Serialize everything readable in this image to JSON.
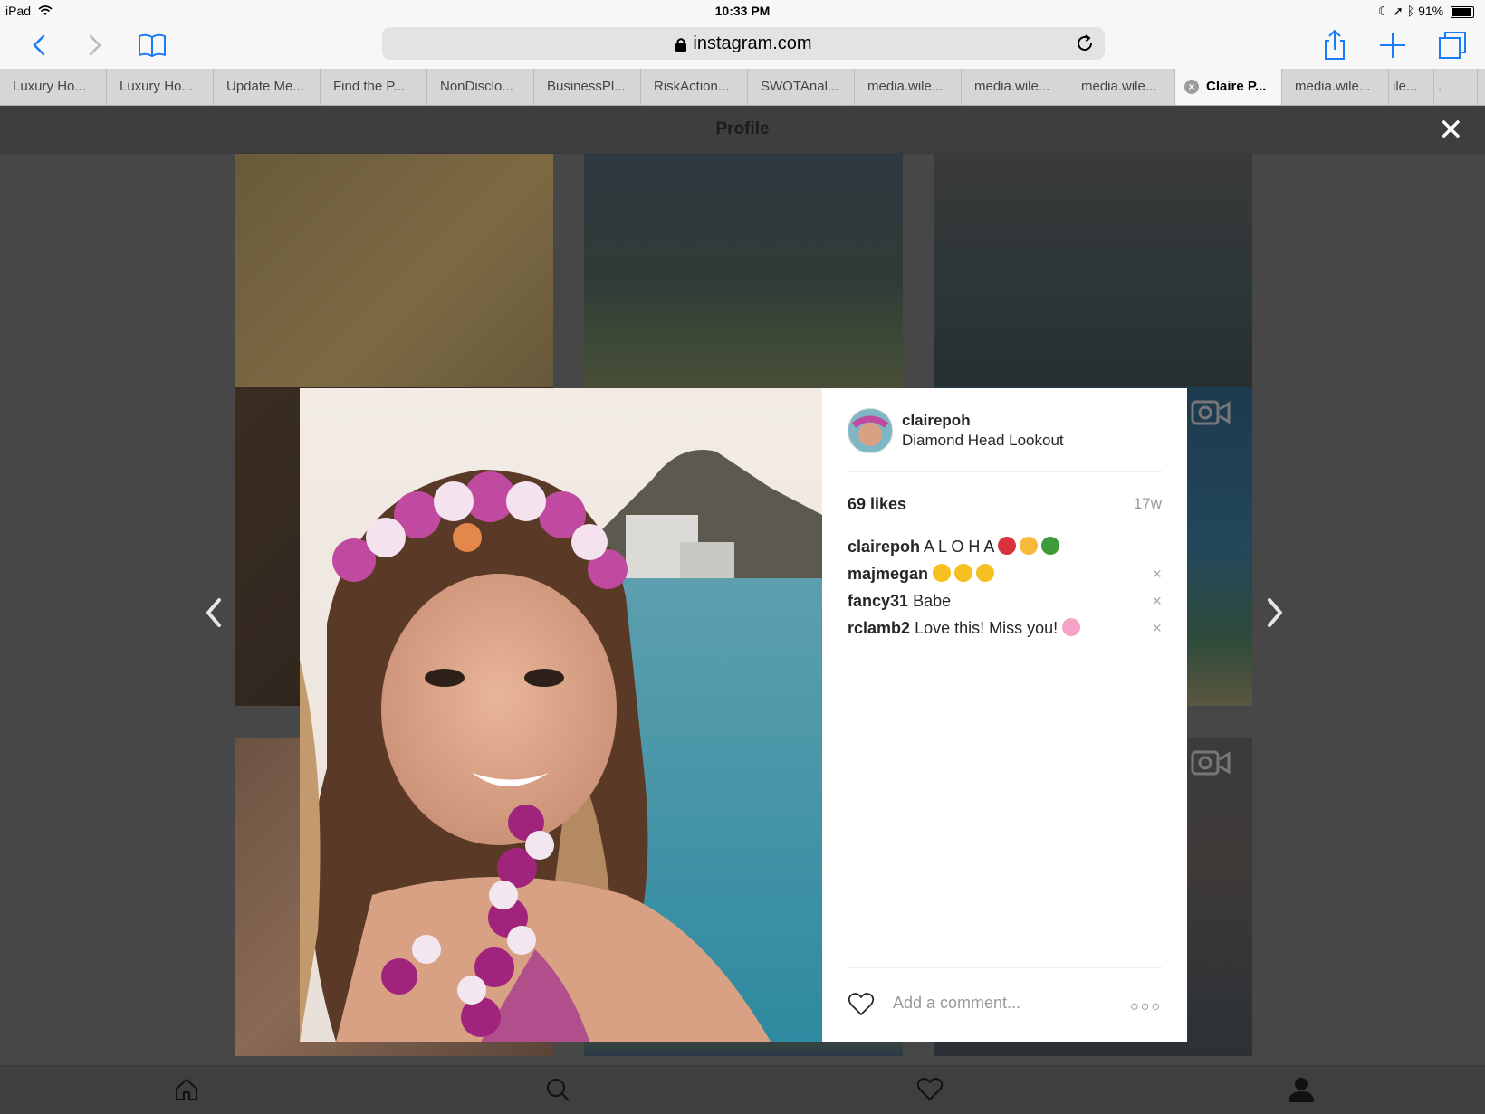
{
  "status_bar": {
    "device": "iPad",
    "time": "10:33 PM",
    "battery": "91%",
    "battery_level": 0.91
  },
  "browser": {
    "url": "instagram.com",
    "tabs": [
      {
        "label": "Luxury Ho..."
      },
      {
        "label": "Luxury Ho..."
      },
      {
        "label": "Update Me..."
      },
      {
        "label": "Find the P..."
      },
      {
        "label": "NonDisclo..."
      },
      {
        "label": "BusinessPl..."
      },
      {
        "label": "RiskAction..."
      },
      {
        "label": "SWOTAnal..."
      },
      {
        "label": "media.wile..."
      },
      {
        "label": "media.wile..."
      },
      {
        "label": "media.wile..."
      },
      {
        "label": "Claire P..."
      },
      {
        "label": "media.wile..."
      },
      {
        "label": "ile..."
      },
      {
        "label": "."
      }
    ],
    "active_tab_index": 11
  },
  "page": {
    "header_title": "Profile"
  },
  "post": {
    "username": "clairepoh",
    "location": "Diamond Head Lookout",
    "likes": "69 likes",
    "age": "17w",
    "comments": [
      {
        "user": "clairepoh",
        "text": "A L O H A",
        "emoji": [
          "hibiscus",
          "thumbs-up",
          "palm-tree"
        ],
        "removable": false
      },
      {
        "user": "majmegan",
        "text": "",
        "emoji": [
          "heart-eyes",
          "heart-eyes",
          "heart-eyes"
        ],
        "removable": true
      },
      {
        "user": "fancy31",
        "text": "Babe",
        "emoji": [],
        "removable": true
      },
      {
        "user": "rclamb2",
        "text": "Love this! Miss you!",
        "emoji": [
          "cherry-blossom"
        ],
        "removable": true
      }
    ],
    "comment_placeholder": "Add a comment...",
    "remove_glyph": "×",
    "more_glyph": "○○○"
  },
  "close_glyph": "✕",
  "colors": {
    "ios_blue": "#1a7cf5",
    "overlay": "#474747",
    "text": "#262626"
  }
}
